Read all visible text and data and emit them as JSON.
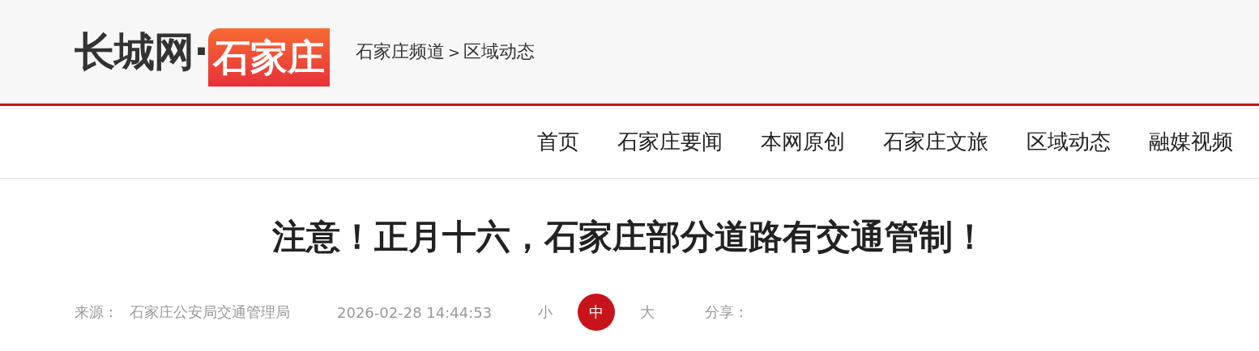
{
  "logo": {
    "site": "长城网·",
    "channel": "石家庄"
  },
  "breadcrumb": {
    "items": [
      "石家庄频道",
      "区域动态"
    ],
    "separator": ">"
  },
  "nav": [
    {
      "label": "首页",
      "selected": false
    },
    {
      "label": "石家庄要闻",
      "selected": false
    },
    {
      "label": "本网原创",
      "selected": false
    },
    {
      "label": "石家庄文旅",
      "selected": false
    },
    {
      "label": "区域动态",
      "selected": false
    },
    {
      "label": "融媒视频",
      "selected": false
    }
  ],
  "article": {
    "title": "注意！正月十六，石家庄部分道路有交通管制！"
  },
  "meta": {
    "source_label": "来源：",
    "source": "石家庄公安局交通管理局",
    "date": "2026-02-28 14:44:53",
    "font_sizes": [
      {
        "label": "小",
        "selected": false
      },
      {
        "label": "中",
        "selected": true
      },
      {
        "label": "大",
        "selected": false
      }
    ],
    "share_label": "分享："
  }
}
